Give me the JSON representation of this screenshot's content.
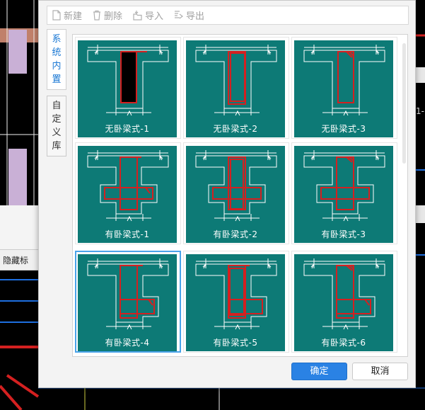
{
  "background": {
    "toolbar_label": "隐藏标",
    "right_text": "1-"
  },
  "toolbar": {
    "new_label": "新建",
    "delete_label": "删除",
    "import_label": "导入",
    "export_label": "导出"
  },
  "side_tabs": [
    {
      "chars": [
        "系",
        "统",
        "内",
        "置"
      ],
      "active": true
    },
    {
      "chars": [
        "自",
        "定",
        "义",
        "库"
      ],
      "active": false
    }
  ],
  "styles": [
    {
      "label": "无卧梁式-1",
      "kind": "plain",
      "variant": 1,
      "selected": false
    },
    {
      "label": "无卧梁式-2",
      "kind": "plain",
      "variant": 2,
      "selected": false
    },
    {
      "label": "无卧梁式-3",
      "kind": "plain",
      "variant": 3,
      "selected": false
    },
    {
      "label": "有卧梁式-1",
      "kind": "cross",
      "variant": 1,
      "selected": false
    },
    {
      "label": "有卧梁式-2",
      "kind": "cross",
      "variant": 2,
      "selected": false
    },
    {
      "label": "有卧梁式-3",
      "kind": "cross",
      "variant": 3,
      "selected": false
    },
    {
      "label": "有卧梁式-4",
      "kind": "side",
      "variant": 1,
      "selected": true
    },
    {
      "label": "有卧梁式-5",
      "kind": "side",
      "variant": 2,
      "selected": false
    },
    {
      "label": "有卧梁式-6",
      "kind": "side",
      "variant": 3,
      "selected": false
    }
  ],
  "buttons": {
    "ok_label": "确定",
    "cancel_label": "取消"
  },
  "colors": {
    "thumb_bg": "#0d7a76",
    "rebar": "#d42020",
    "outline": "#ffffff",
    "accent": "#2a82e4"
  }
}
